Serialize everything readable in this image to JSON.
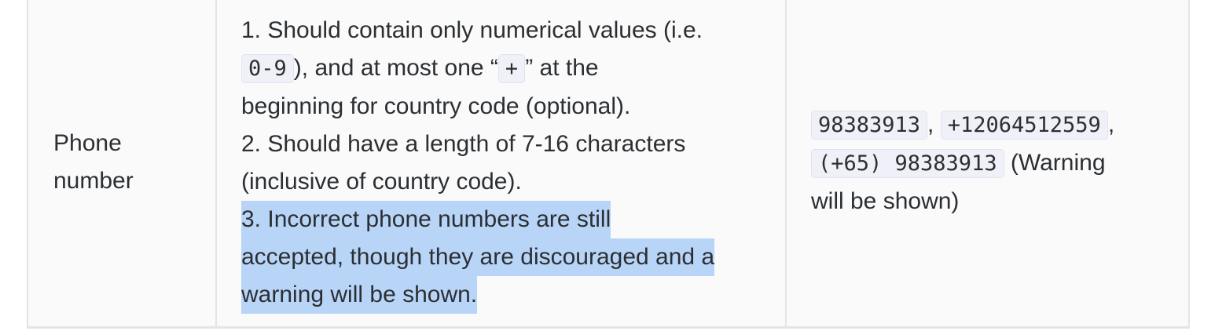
{
  "field": {
    "line1": "Phone",
    "line2": "number"
  },
  "rules": {
    "r1_a": "1. Should contain only numerical values (i.e.",
    "r1_code1": "0-9",
    "r1_b": "), and at most one “",
    "r1_code2": "+",
    "r1_c": "” at the",
    "r1_d": "beginning for country code (optional).",
    "r2_a": "2. Should have a length of 7-16 characters",
    "r2_b": "(inclusive of country code).",
    "r3_a": "3. Incorrect phone numbers are still",
    "r3_b": "accepted, though they are discouraged and a",
    "r3_c": "warning will be shown."
  },
  "example": {
    "code1": "98383913",
    "sep1": ",",
    "code2": "+12064512559",
    "sep2": ",",
    "code3": "(+65) 98383913",
    "warning_a": " (Warning",
    "warning_b": "will be shown)"
  },
  "colors": {
    "selection_highlight": "#b8d5f7",
    "code_background": "#f0f0f8",
    "table_border": "#e4e4e4"
  }
}
